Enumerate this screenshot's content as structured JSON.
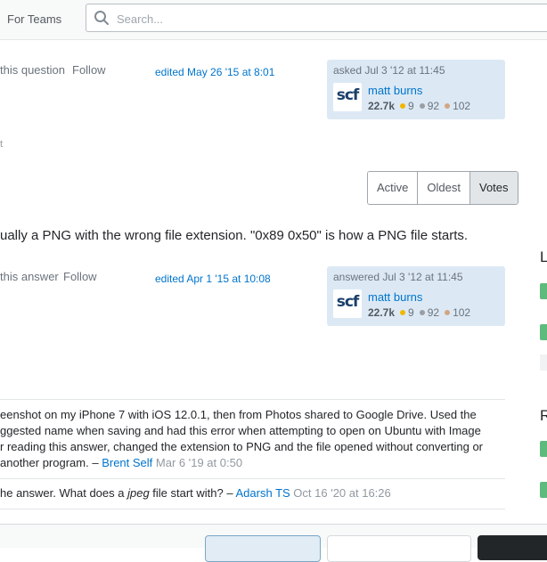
{
  "header": {
    "for_teams": "For Teams",
    "search_placeholder": "Search..."
  },
  "question": {
    "share_text": "this question",
    "follow": "Follow",
    "edited": "edited May 26 '15 at 8:01",
    "asked": "asked Jul 3 '12 at 11:45",
    "user": {
      "avatar_text": "scf",
      "name": "matt burns",
      "rep": "22.7k",
      "gold": "9",
      "silver": "92",
      "bronze": "102"
    },
    "comment_fragment": "t"
  },
  "sort_tabs": [
    "Active",
    "Oldest",
    "Votes"
  ],
  "answer": {
    "text": "ually a PNG with the wrong file extension. \"0x89 0x50\" is how a PNG file starts.",
    "share_text": "this answer",
    "follow": "Follow",
    "edited": "edited Apr 1 '15 at 10:08",
    "answered": "answered Jul 3 '12 at 11:45",
    "user": {
      "avatar_text": "scf",
      "name": "matt burns",
      "rep": "22.7k",
      "gold": "9",
      "silver": "92",
      "bronze": "102"
    }
  },
  "comments": [
    {
      "lines": [
        "eenshot on my iPhone 7 with iOS 12.0.1, then from Photos shared to Google Drive. Used the",
        "ggested name when saving and had this error when attempting to open on Ubuntu with Image",
        "r reading this answer, changed the extension to PNG and the file opened without converting or"
      ],
      "last_line": " another program. – ",
      "author": "Brent Self",
      "date": " Mar 6 '19 at 0:50"
    },
    {
      "pre": "he answer. What does a ",
      "em": "jpeg",
      "post": " file start with? – ",
      "author": "Adarsh TS",
      "date": " Oct 16 '20 at 16:26"
    }
  ],
  "sidebar": {
    "letter_1": "L",
    "letter_2": "R"
  },
  "colors": {
    "link": "#0074cc",
    "card_bg": "#dce9f5",
    "gold": "#f1b600",
    "silver": "#9a9ea2",
    "bronze": "#d1a684",
    "sidebar_green": "#5eba7d"
  }
}
